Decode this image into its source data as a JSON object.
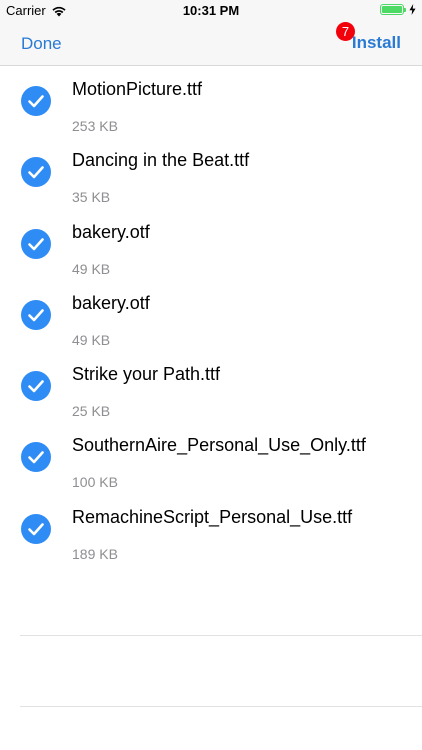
{
  "status_bar": {
    "carrier": "Carrier",
    "time": "10:31 PM",
    "wifi_icon": "wifi-icon",
    "battery_icon": "battery-full-icon",
    "charging_icon": "bolt-icon"
  },
  "nav": {
    "done_label": "Done",
    "install_label": "Install",
    "badge_count": "7",
    "accent_color": "#2a7ad4",
    "badge_color": "#f2000b"
  },
  "fonts": [
    {
      "name": "MotionPicture.ttf",
      "size": "253 KB",
      "selected": true
    },
    {
      "name": "Dancing in the Beat.ttf",
      "size": "35 KB",
      "selected": true
    },
    {
      "name": "bakery.otf",
      "size": "49 KB",
      "selected": true
    },
    {
      "name": "bakery.otf",
      "size": "49 KB",
      "selected": true
    },
    {
      "name": "Strike your Path.ttf",
      "size": "25 KB",
      "selected": true
    },
    {
      "name": "SouthernAire_Personal_Use_Only.ttf",
      "size": "100 KB",
      "selected": true
    },
    {
      "name": "RemachineScript_Personal_Use.ttf",
      "size": "189 KB",
      "selected": true
    }
  ],
  "check_color": "#2f8cf5"
}
